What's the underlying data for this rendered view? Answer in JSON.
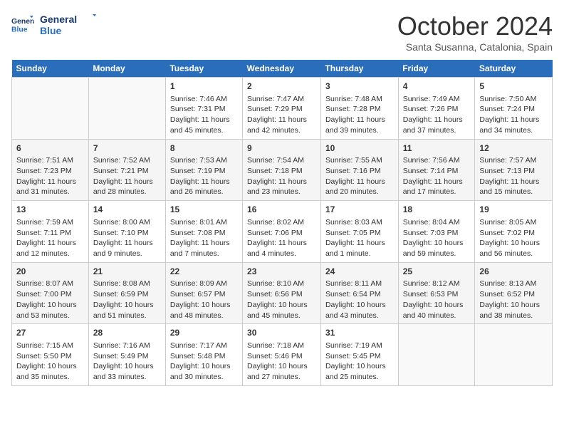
{
  "header": {
    "logo_line1": "General",
    "logo_line2": "Blue",
    "month": "October 2024",
    "location": "Santa Susanna, Catalonia, Spain"
  },
  "days_of_week": [
    "Sunday",
    "Monday",
    "Tuesday",
    "Wednesday",
    "Thursday",
    "Friday",
    "Saturday"
  ],
  "weeks": [
    [
      {
        "day": "",
        "sunrise": "",
        "sunset": "",
        "daylight": ""
      },
      {
        "day": "",
        "sunrise": "",
        "sunset": "",
        "daylight": ""
      },
      {
        "day": "1",
        "sunrise": "Sunrise: 7:46 AM",
        "sunset": "Sunset: 7:31 PM",
        "daylight": "Daylight: 11 hours and 45 minutes."
      },
      {
        "day": "2",
        "sunrise": "Sunrise: 7:47 AM",
        "sunset": "Sunset: 7:29 PM",
        "daylight": "Daylight: 11 hours and 42 minutes."
      },
      {
        "day": "3",
        "sunrise": "Sunrise: 7:48 AM",
        "sunset": "Sunset: 7:28 PM",
        "daylight": "Daylight: 11 hours and 39 minutes."
      },
      {
        "day": "4",
        "sunrise": "Sunrise: 7:49 AM",
        "sunset": "Sunset: 7:26 PM",
        "daylight": "Daylight: 11 hours and 37 minutes."
      },
      {
        "day": "5",
        "sunrise": "Sunrise: 7:50 AM",
        "sunset": "Sunset: 7:24 PM",
        "daylight": "Daylight: 11 hours and 34 minutes."
      }
    ],
    [
      {
        "day": "6",
        "sunrise": "Sunrise: 7:51 AM",
        "sunset": "Sunset: 7:23 PM",
        "daylight": "Daylight: 11 hours and 31 minutes."
      },
      {
        "day": "7",
        "sunrise": "Sunrise: 7:52 AM",
        "sunset": "Sunset: 7:21 PM",
        "daylight": "Daylight: 11 hours and 28 minutes."
      },
      {
        "day": "8",
        "sunrise": "Sunrise: 7:53 AM",
        "sunset": "Sunset: 7:19 PM",
        "daylight": "Daylight: 11 hours and 26 minutes."
      },
      {
        "day": "9",
        "sunrise": "Sunrise: 7:54 AM",
        "sunset": "Sunset: 7:18 PM",
        "daylight": "Daylight: 11 hours and 23 minutes."
      },
      {
        "day": "10",
        "sunrise": "Sunrise: 7:55 AM",
        "sunset": "Sunset: 7:16 PM",
        "daylight": "Daylight: 11 hours and 20 minutes."
      },
      {
        "day": "11",
        "sunrise": "Sunrise: 7:56 AM",
        "sunset": "Sunset: 7:14 PM",
        "daylight": "Daylight: 11 hours and 17 minutes."
      },
      {
        "day": "12",
        "sunrise": "Sunrise: 7:57 AM",
        "sunset": "Sunset: 7:13 PM",
        "daylight": "Daylight: 11 hours and 15 minutes."
      }
    ],
    [
      {
        "day": "13",
        "sunrise": "Sunrise: 7:59 AM",
        "sunset": "Sunset: 7:11 PM",
        "daylight": "Daylight: 11 hours and 12 minutes."
      },
      {
        "day": "14",
        "sunrise": "Sunrise: 8:00 AM",
        "sunset": "Sunset: 7:10 PM",
        "daylight": "Daylight: 11 hours and 9 minutes."
      },
      {
        "day": "15",
        "sunrise": "Sunrise: 8:01 AM",
        "sunset": "Sunset: 7:08 PM",
        "daylight": "Daylight: 11 hours and 7 minutes."
      },
      {
        "day": "16",
        "sunrise": "Sunrise: 8:02 AM",
        "sunset": "Sunset: 7:06 PM",
        "daylight": "Daylight: 11 hours and 4 minutes."
      },
      {
        "day": "17",
        "sunrise": "Sunrise: 8:03 AM",
        "sunset": "Sunset: 7:05 PM",
        "daylight": "Daylight: 11 hours and 1 minute."
      },
      {
        "day": "18",
        "sunrise": "Sunrise: 8:04 AM",
        "sunset": "Sunset: 7:03 PM",
        "daylight": "Daylight: 10 hours and 59 minutes."
      },
      {
        "day": "19",
        "sunrise": "Sunrise: 8:05 AM",
        "sunset": "Sunset: 7:02 PM",
        "daylight": "Daylight: 10 hours and 56 minutes."
      }
    ],
    [
      {
        "day": "20",
        "sunrise": "Sunrise: 8:07 AM",
        "sunset": "Sunset: 7:00 PM",
        "daylight": "Daylight: 10 hours and 53 minutes."
      },
      {
        "day": "21",
        "sunrise": "Sunrise: 8:08 AM",
        "sunset": "Sunset: 6:59 PM",
        "daylight": "Daylight: 10 hours and 51 minutes."
      },
      {
        "day": "22",
        "sunrise": "Sunrise: 8:09 AM",
        "sunset": "Sunset: 6:57 PM",
        "daylight": "Daylight: 10 hours and 48 minutes."
      },
      {
        "day": "23",
        "sunrise": "Sunrise: 8:10 AM",
        "sunset": "Sunset: 6:56 PM",
        "daylight": "Daylight: 10 hours and 45 minutes."
      },
      {
        "day": "24",
        "sunrise": "Sunrise: 8:11 AM",
        "sunset": "Sunset: 6:54 PM",
        "daylight": "Daylight: 10 hours and 43 minutes."
      },
      {
        "day": "25",
        "sunrise": "Sunrise: 8:12 AM",
        "sunset": "Sunset: 6:53 PM",
        "daylight": "Daylight: 10 hours and 40 minutes."
      },
      {
        "day": "26",
        "sunrise": "Sunrise: 8:13 AM",
        "sunset": "Sunset: 6:52 PM",
        "daylight": "Daylight: 10 hours and 38 minutes."
      }
    ],
    [
      {
        "day": "27",
        "sunrise": "Sunrise: 7:15 AM",
        "sunset": "Sunset: 5:50 PM",
        "daylight": "Daylight: 10 hours and 35 minutes."
      },
      {
        "day": "28",
        "sunrise": "Sunrise: 7:16 AM",
        "sunset": "Sunset: 5:49 PM",
        "daylight": "Daylight: 10 hours and 33 minutes."
      },
      {
        "day": "29",
        "sunrise": "Sunrise: 7:17 AM",
        "sunset": "Sunset: 5:48 PM",
        "daylight": "Daylight: 10 hours and 30 minutes."
      },
      {
        "day": "30",
        "sunrise": "Sunrise: 7:18 AM",
        "sunset": "Sunset: 5:46 PM",
        "daylight": "Daylight: 10 hours and 27 minutes."
      },
      {
        "day": "31",
        "sunrise": "Sunrise: 7:19 AM",
        "sunset": "Sunset: 5:45 PM",
        "daylight": "Daylight: 10 hours and 25 minutes."
      },
      {
        "day": "",
        "sunrise": "",
        "sunset": "",
        "daylight": ""
      },
      {
        "day": "",
        "sunrise": "",
        "sunset": "",
        "daylight": ""
      }
    ]
  ]
}
